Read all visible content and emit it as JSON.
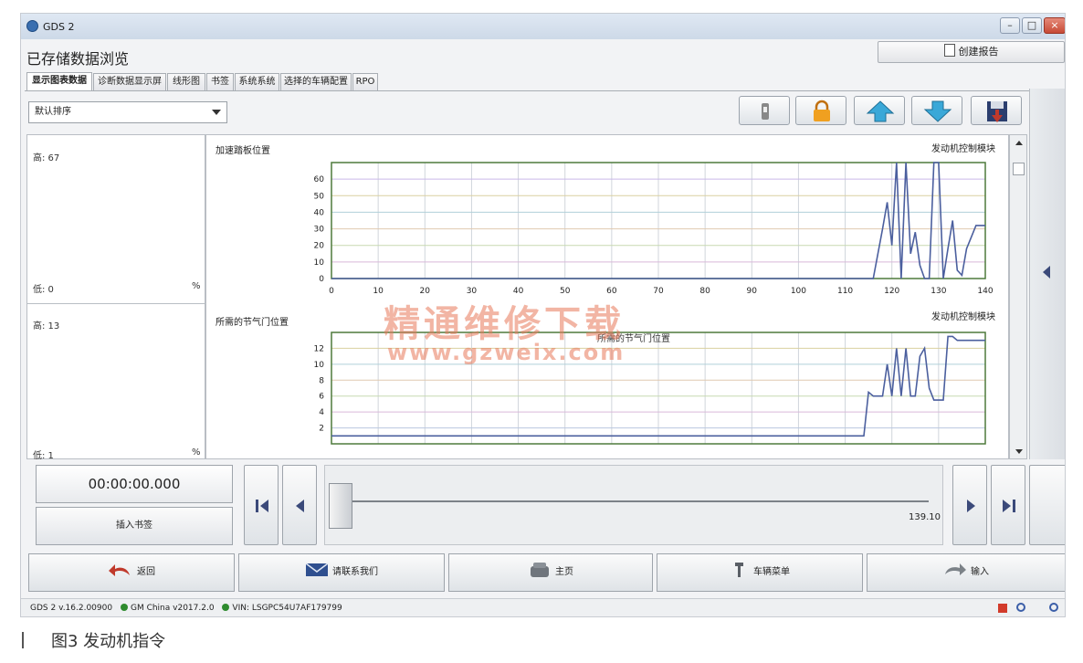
{
  "window": {
    "title": "GDS 2",
    "min_label": "–",
    "max_label": "□",
    "close_label": "×"
  },
  "page": {
    "title": "已存储数据浏览",
    "report_button": "创建报告"
  },
  "tabs": [
    "显示图表数据",
    "诊断数据显示屏",
    "线形图",
    "书签",
    "系统系统",
    "选择的车辆配置",
    "RPO"
  ],
  "active_tab": 0,
  "sort": {
    "value": "默认排序"
  },
  "toolbar": {
    "icons": [
      "ignition-icon",
      "lock-icon",
      "arrow-up-icon",
      "arrow-down-icon",
      "save-icon"
    ],
    "lock_color": "#f0a020",
    "arrow_color": "#3aa8d8"
  },
  "left_panel": {
    "chart1_high": "高: 67",
    "chart1_low": "低: 0",
    "chart1_unit": "%",
    "chart2_high": "高: 13",
    "chart2_low": "低: 1",
    "chart2_unit": "%"
  },
  "chart_data": [
    {
      "type": "line",
      "title": "加速踏板位置",
      "source_label": "发动机控制模块",
      "x": [
        0,
        10,
        20,
        30,
        40,
        50,
        60,
        70,
        80,
        90,
        100,
        110,
        115,
        116,
        118,
        119,
        120,
        121,
        122,
        123,
        124,
        125,
        126,
        127,
        128,
        129,
        130,
        131,
        132,
        133,
        134,
        135,
        136,
        137,
        138,
        140
      ],
      "series": [
        {
          "values": [
            0,
            0,
            0,
            0,
            0,
            0,
            0,
            0,
            0,
            0,
            0,
            0,
            0,
            0,
            30,
            46,
            20,
            70,
            0,
            70,
            15,
            28,
            8,
            0,
            0,
            70,
            70,
            0,
            18,
            35,
            5,
            2,
            18,
            25,
            32,
            32
          ]
        }
      ],
      "xlim": [
        0,
        140
      ],
      "ylim": [
        0,
        70
      ],
      "xticks": [
        0,
        10,
        20,
        30,
        40,
        50,
        60,
        70,
        80,
        90,
        100,
        110,
        120,
        130,
        140
      ],
      "yticks": [
        0,
        10,
        20,
        30,
        40,
        50,
        60
      ],
      "grid": true
    },
    {
      "type": "line",
      "title": "所需的节气门位置",
      "source_label": "发动机控制模块",
      "x": [
        0,
        10,
        20,
        30,
        40,
        50,
        60,
        70,
        80,
        90,
        100,
        110,
        114,
        115,
        116,
        118,
        119,
        120,
        121,
        122,
        123,
        124,
        125,
        126,
        127,
        128,
        129,
        130,
        131,
        132,
        133,
        134,
        135,
        136,
        137,
        138,
        140
      ],
      "series": [
        {
          "values": [
            1,
            1,
            1,
            1,
            1,
            1,
            1,
            1,
            1,
            1,
            1,
            1,
            1,
            6.5,
            6,
            6,
            10,
            6,
            12,
            6,
            12,
            6,
            6,
            11,
            12,
            7,
            5.5,
            5.5,
            5.5,
            13.5,
            13.5,
            13,
            13,
            13,
            13,
            13,
            13
          ]
        }
      ],
      "xlim": [
        0,
        140
      ],
      "ylim": [
        0,
        14
      ],
      "yticks": [
        2,
        4,
        6,
        8,
        10,
        12
      ],
      "grid": true
    }
  ],
  "overlay_label": "所需的节气门位置",
  "playback": {
    "time": "00:00:00.000",
    "insert_bookmark": "插入书签",
    "position": "139.10"
  },
  "bottom_nav": {
    "back": "返回",
    "contact": "请联系我们",
    "home": "主页",
    "vehicle_menu": "车辆菜单",
    "input": "输入"
  },
  "status": {
    "version": "GDS 2 v.16.2.00900",
    "gm": "GM China v2017.2.0",
    "vin": "VIN: LSGPC54U7AF179799"
  },
  "watermark": {
    "line1": "精通维修下载",
    "line2": "www.gzweix.com"
  },
  "caption": "图3  发动机指令"
}
